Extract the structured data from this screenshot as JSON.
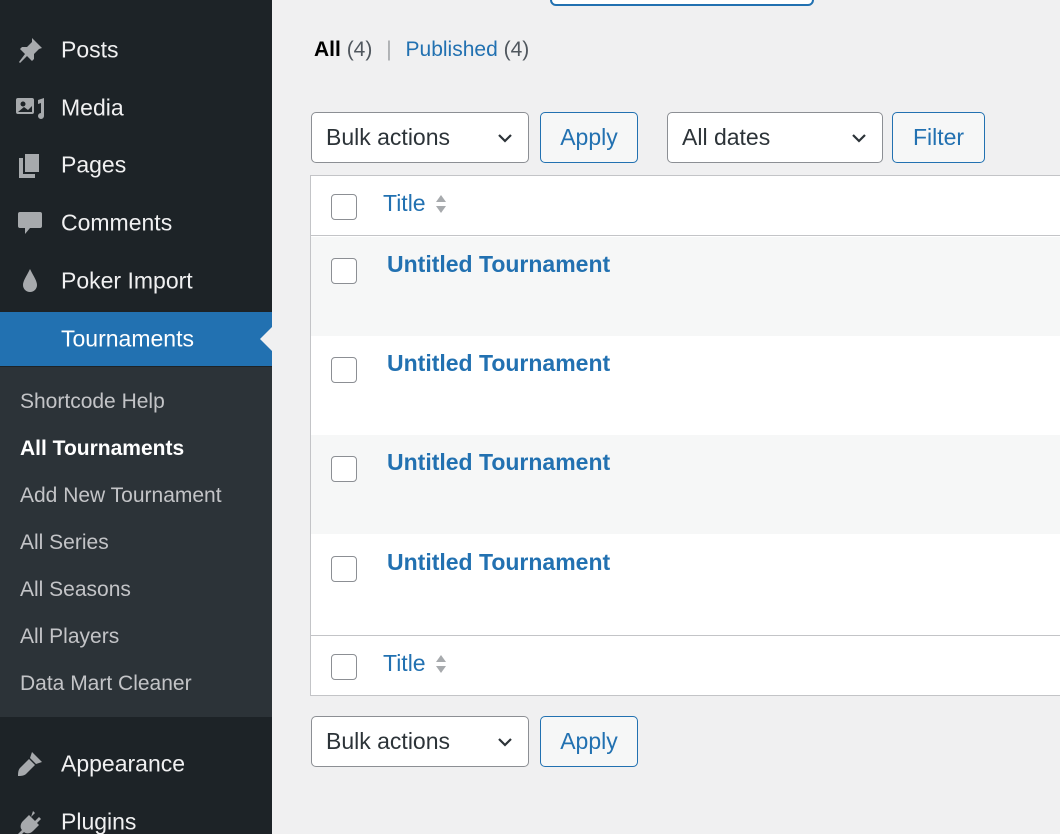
{
  "sidebar": {
    "items": [
      {
        "label": "Posts",
        "icon": "pin-icon"
      },
      {
        "label": "Media",
        "icon": "media-icon"
      },
      {
        "label": "Pages",
        "icon": "pages-icon"
      },
      {
        "label": "Comments",
        "icon": "comment-icon"
      },
      {
        "label": "Poker Import",
        "icon": "drop-icon"
      },
      {
        "label": "Tournaments",
        "icon": ""
      }
    ],
    "submenu": [
      {
        "label": "Shortcode Help"
      },
      {
        "label": "All Tournaments"
      },
      {
        "label": "Add New Tournament"
      },
      {
        "label": "All Series"
      },
      {
        "label": "All Seasons"
      },
      {
        "label": "All Players"
      },
      {
        "label": "Data Mart Cleaner"
      }
    ],
    "bottom_items": [
      {
        "label": "Appearance",
        "icon": "brush-icon"
      },
      {
        "label": "Plugins",
        "icon": "plug-icon"
      }
    ]
  },
  "views": {
    "all_label": "All",
    "all_count": "(4)",
    "separator": "|",
    "published_label": "Published",
    "published_count": "(4)"
  },
  "filters": {
    "bulk_actions_label": "Bulk actions",
    "apply_label": "Apply",
    "dates_label": "All dates",
    "filter_label": "Filter"
  },
  "table": {
    "column_title": "Title",
    "rows": [
      {
        "title": "Untitled Tournament"
      },
      {
        "title": "Untitled Tournament"
      },
      {
        "title": "Untitled Tournament"
      },
      {
        "title": "Untitled Tournament"
      }
    ]
  },
  "colors": {
    "sidebar_bg": "#1d2327",
    "submenu_bg": "#2c3338",
    "accent": "#2271b1",
    "page_bg": "#f0f0f1"
  }
}
